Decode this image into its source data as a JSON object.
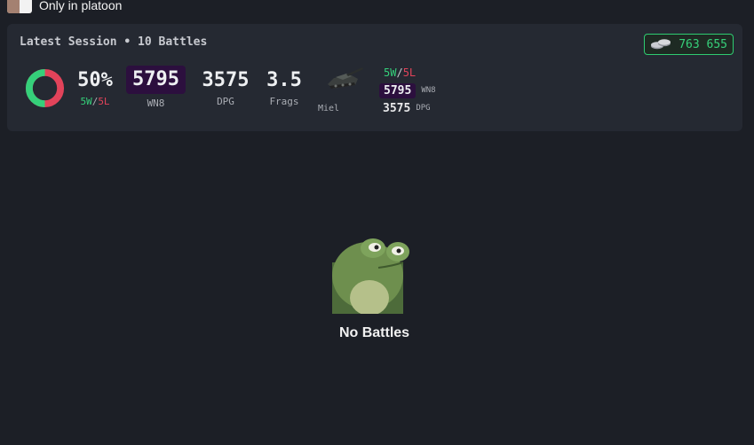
{
  "filter": {
    "toggle_label": "Only in platoon"
  },
  "session": {
    "title": "Latest Session • 10 Battles",
    "credits": "763 655",
    "winrate": "50%",
    "wins": "5W",
    "losses": "5L",
    "win_fraction": 0.5,
    "wn8": "5795",
    "wn8_label": "WN8",
    "dpg": "3575",
    "dpg_label": "DPG",
    "frags": "3.5",
    "frags_label": "Frags"
  },
  "tank": {
    "name": "Miel",
    "wins": "5W",
    "losses": "5L",
    "wn8": "5795",
    "wn8_label": "WN8",
    "dpg": "3575",
    "dpg_label": "DPG"
  },
  "empty_state": {
    "message": "No Battles"
  },
  "colors": {
    "win": "#35d07a",
    "loss": "#e2435a",
    "wn8_bg": "#2c0f3e",
    "accent": "#2ecc71"
  },
  "icons": {
    "credits": "silver-coins-icon",
    "tank": "tank-icon",
    "empty": "sad-frog-icon",
    "winrate": "winrate-donut-icon"
  }
}
